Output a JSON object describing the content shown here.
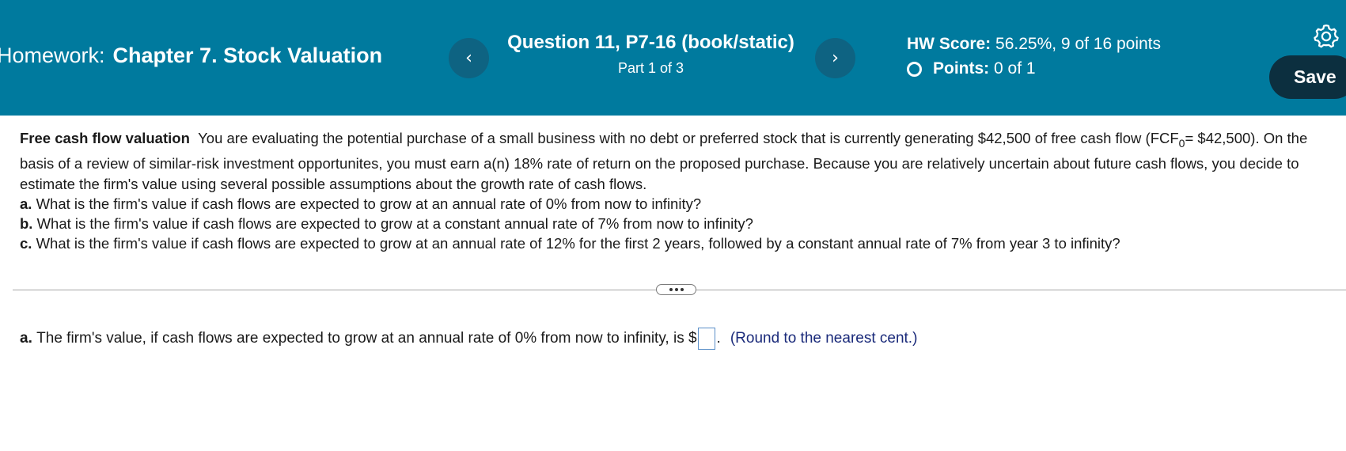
{
  "header": {
    "homework_label": "Homework:",
    "homework_title": "Chapter 7. Stock Valuation",
    "question_title": "Question 11, P7-16 (book/static)",
    "question_part": "Part 1 of 3",
    "prev_icon": "chevron-left-icon",
    "prev_glyph": "‹",
    "next_icon": "chevron-right-icon",
    "next_glyph": "›",
    "hw_score_label": "HW Score:",
    "hw_score_value": "56.25%, 9 of 16 points",
    "points_label": "Points:",
    "points_value": "0 of 1",
    "settings_icon": "gear-icon",
    "save_label": "Save"
  },
  "problem": {
    "heading": "Free cash flow valuation",
    "intro_1": "You are evaluating the potential purchase of a small business with no debt or preferred stock that is currently generating $42,500 of free cash flow (FCF",
    "intro_sub": "0",
    "intro_2": "= $42,500). On the basis of a review of similar-risk investment opportunites, you must earn a(n) 18% rate of return on the proposed purchase. Because you are relatively uncertain about future cash flows, you decide to estimate the firm's value using several possible assumptions about the growth rate of cash flows.",
    "items": [
      {
        "letter": "a.",
        "text": "What is the firm's value if cash flows are expected to grow at an annual rate of 0% from now to infinity?"
      },
      {
        "letter": "b.",
        "text": "What is the firm's value if cash flows are expected to grow at a constant annual rate of 7% from now to infinity?"
      },
      {
        "letter": "c.",
        "text": "What is the firm's value if cash flows are expected to grow at an annual rate of 12% for the first 2 years, followed by a constant annual rate of 7% from year 3 to infinity?"
      }
    ]
  },
  "answer": {
    "letter": "a.",
    "text": "The firm's value, if cash flows are expected to grow at an annual rate of 0% from now to infinity, is $",
    "input_value": "",
    "after_input": ".",
    "hint": "(Round to the nearest cent.)"
  },
  "colors": {
    "header_bg": "#007a9e",
    "nav_button_bg": "#0e6382",
    "save_button_bg": "#0c2f3f",
    "hint_text": "#1a2a7a"
  }
}
